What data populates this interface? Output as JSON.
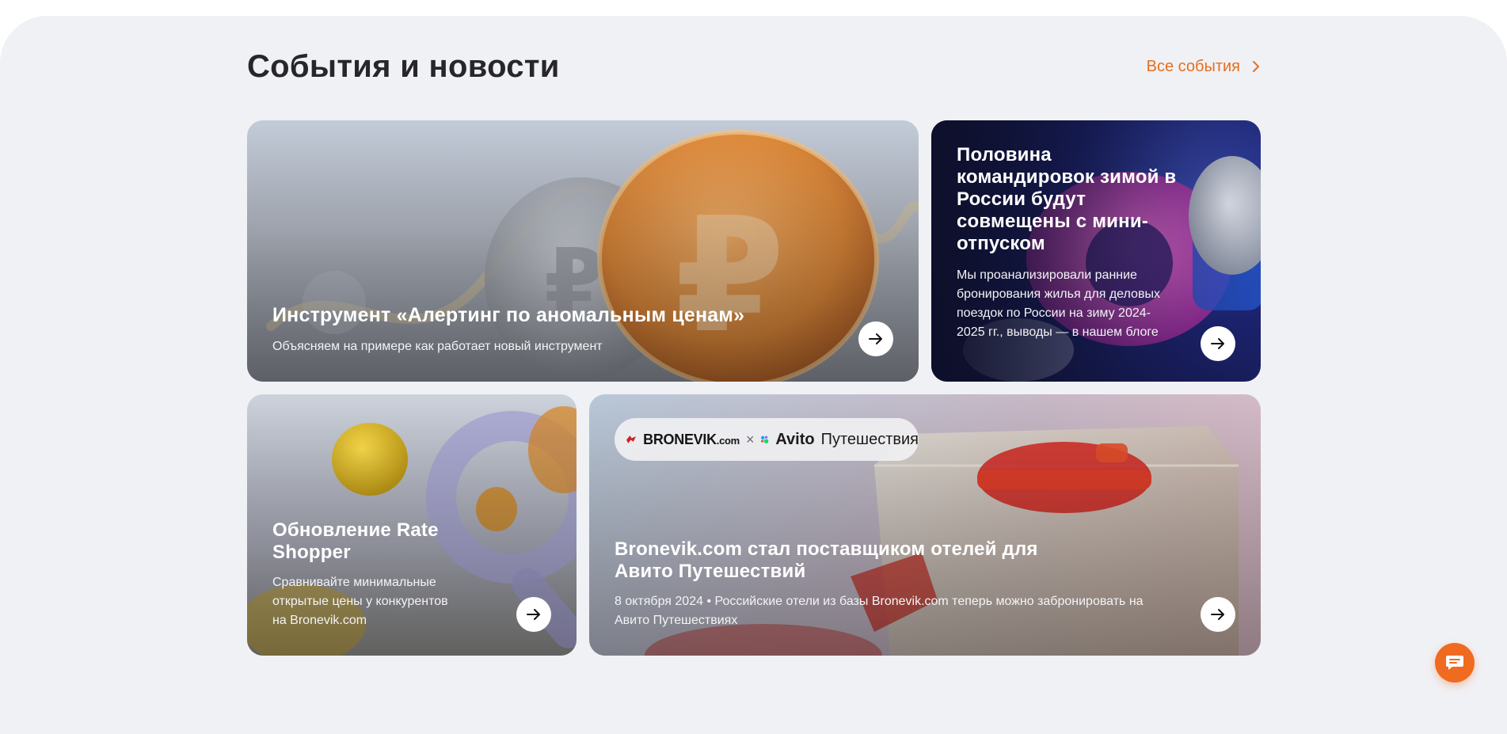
{
  "header": {
    "title": "События и новости",
    "all_events_label": "Все события"
  },
  "cards": [
    {
      "title": "Инструмент «Алертинг по аномальным ценам»",
      "description": "Объясняем на примере как работает новый инструмент"
    },
    {
      "title": "Половина командировок зимой в России будут совмещены с мини-отпуском",
      "description": "Мы проанализировали ранние бронирования жилья для деловых поездок по России на зиму 2024-2025 гг., выводы — в нашем блоге"
    },
    {
      "title": "Обновление Rate Shopper",
      "description": "Сравнивайте минимальные открытые цены у конкурентов на Bronevik.com"
    },
    {
      "title": "Bronevik.com стал поставщиком отелей для Авито Путешествий",
      "description": "8 октября 2024 • Российские отели из базы Bronevik.com теперь можно забронировать на Авито Путешествиях",
      "partner": {
        "bronevik": "BRONEVIK",
        "bronevik_suffix": ".com",
        "separator": "×",
        "avito": "Avito",
        "travel": "Путешествия"
      }
    }
  ],
  "colors": {
    "accent": "#e56f1d",
    "background": "#f0f1f5",
    "title": "#26262b",
    "chat_button": "#f06a1f"
  },
  "icons": {
    "all_events": "chevron-right-icon",
    "card_action": "arrow-right-icon",
    "chat": "chat-icon"
  }
}
